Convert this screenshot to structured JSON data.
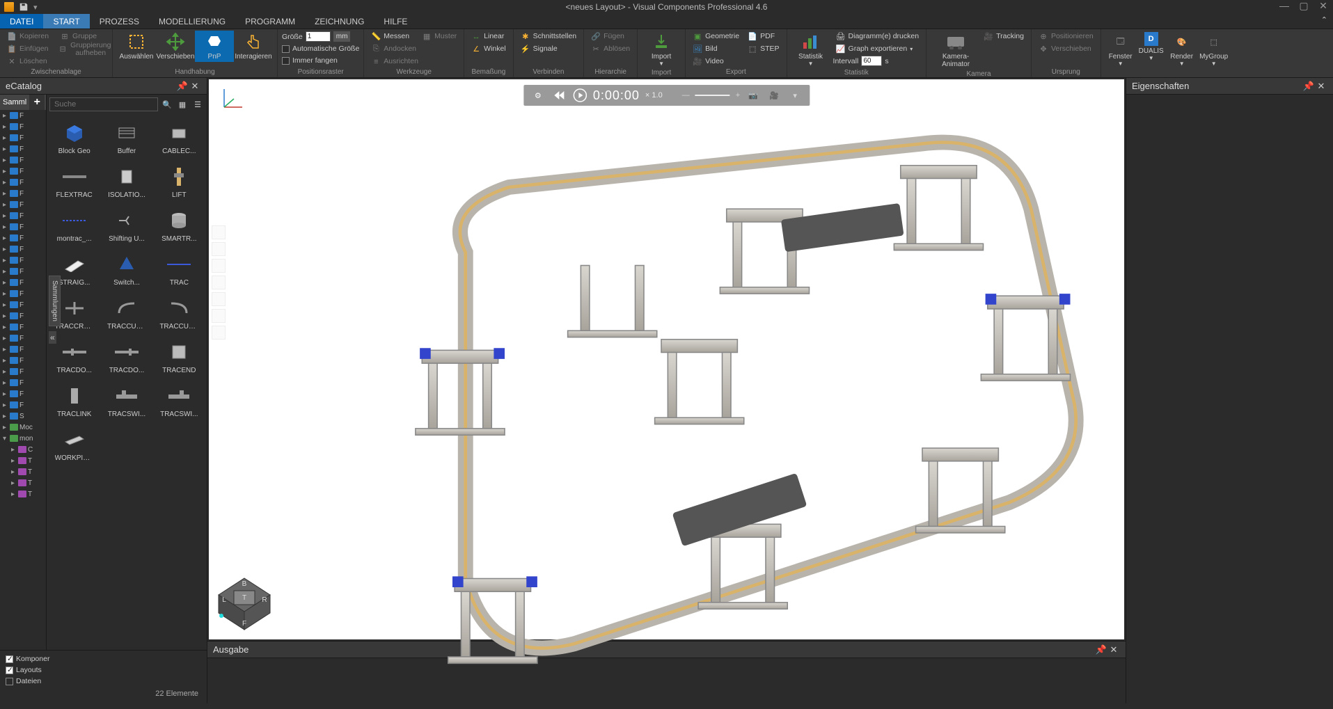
{
  "app": {
    "title": "<neues Layout> - Visual Components Professional 4.6"
  },
  "menu": {
    "tabs": [
      "DATEI",
      "START",
      "PROZESS",
      "MODELLIERUNG",
      "PROGRAMM",
      "ZEICHNUNG",
      "HILFE"
    ],
    "active": 1
  },
  "ribbon": {
    "clipboard": {
      "label": "Zwischenablage",
      "copy": "Kopieren",
      "paste": "Einfügen",
      "delete": "Löschen",
      "group": "Gruppe",
      "ungroup": "Gruppierung aufheben"
    },
    "handling": {
      "label": "Handhabung",
      "select": "Auswählen",
      "move": "Verschieben",
      "pnp": "PnP",
      "interact": "Interagieren"
    },
    "grid": {
      "label": "Positionsraster",
      "size": "Größe",
      "size_val": "1",
      "size_unit": "mm",
      "autosize": "Automatische Größe",
      "snap": "Immer fangen"
    },
    "tools": {
      "label": "Werkzeuge",
      "measure": "Messen",
      "dock": "Andocken",
      "align": "Ausrichten",
      "pattern": "Muster"
    },
    "dimension": {
      "label": "Bemaßung",
      "linear": "Linear",
      "angle": "Winkel"
    },
    "connect": {
      "label": "Verbinden",
      "interfaces": "Schnittstellen",
      "signals": "Signale"
    },
    "hierarchy": {
      "label": "Hierarchie",
      "attach": "Fügen",
      "detach": "Ablösen"
    },
    "import": {
      "label": "Import"
    },
    "export": {
      "label": "Export",
      "geometry": "Geometrie",
      "image": "Bild",
      "video": "Video",
      "pdf": "PDF",
      "step": "STEP"
    },
    "stats": {
      "label": "Statistik",
      "btn": "Statistik",
      "print": "Diagramm(e) drucken",
      "exportg": "Graph exportieren",
      "interval": "Intervall",
      "interval_val": "60",
      "interval_unit": "s"
    },
    "camera": {
      "label": "Kamera",
      "animator": "Kamera-Animator",
      "tracking": "Tracking"
    },
    "origin": {
      "label": "Ursprung",
      "position": "Positionieren",
      "move": "Verschieben"
    },
    "window": {
      "window": "Fenster",
      "dualis": "DUALIS",
      "render": "Render",
      "mygroup": "MyGroup"
    }
  },
  "ecatalog": {
    "title": "eCatalog",
    "collections_tab": "Samml",
    "search_placeholder": "Suche",
    "side_tab": "Sammlungen",
    "tree": [
      {
        "t": "F",
        "c": "b"
      },
      {
        "t": "F",
        "c": "b"
      },
      {
        "t": "F",
        "c": "b"
      },
      {
        "t": "F",
        "c": "b"
      },
      {
        "t": "F",
        "c": "b"
      },
      {
        "t": "F",
        "c": "b"
      },
      {
        "t": "F",
        "c": "b"
      },
      {
        "t": "F",
        "c": "b"
      },
      {
        "t": "F",
        "c": "b"
      },
      {
        "t": "F",
        "c": "b"
      },
      {
        "t": "F",
        "c": "b"
      },
      {
        "t": "F",
        "c": "b"
      },
      {
        "t": "F",
        "c": "b"
      },
      {
        "t": "F",
        "c": "b"
      },
      {
        "t": "F",
        "c": "b"
      },
      {
        "t": "F",
        "c": "b"
      },
      {
        "t": "F",
        "c": "b"
      },
      {
        "t": "F",
        "c": "b"
      },
      {
        "t": "F",
        "c": "b"
      },
      {
        "t": "F",
        "c": "b"
      },
      {
        "t": "F",
        "c": "b"
      },
      {
        "t": "F",
        "c": "b"
      },
      {
        "t": "F",
        "c": "b"
      },
      {
        "t": "F",
        "c": "b"
      },
      {
        "t": "F",
        "c": "b"
      },
      {
        "t": "F",
        "c": "b"
      },
      {
        "t": "F",
        "c": "b"
      },
      {
        "t": "S",
        "c": "b"
      },
      {
        "t": "Moc",
        "c": "g"
      },
      {
        "t": "mon",
        "c": "g",
        "open": true
      },
      {
        "t": "C",
        "c": "p",
        "indent": 1
      },
      {
        "t": "T",
        "c": "p",
        "indent": 1
      },
      {
        "t": "T",
        "c": "p",
        "indent": 1
      },
      {
        "t": "T",
        "c": "p",
        "indent": 1
      },
      {
        "t": "T",
        "c": "p",
        "indent": 1
      }
    ],
    "items": [
      {
        "label": "Block Geo",
        "shape": "cube"
      },
      {
        "label": "Buffer",
        "shape": "buffer"
      },
      {
        "label": "CABLEC...",
        "shape": "cable"
      },
      {
        "label": "FLEXTRAC",
        "shape": "track"
      },
      {
        "label": "ISOLATIO...",
        "shape": "iso"
      },
      {
        "label": "LIFT",
        "shape": "lift"
      },
      {
        "label": "montrac_...",
        "shape": "mtrack"
      },
      {
        "label": "Shifting U...",
        "shape": "shift"
      },
      {
        "label": "SMARTR...",
        "shape": "smart"
      },
      {
        "label": "STRAIG...",
        "shape": "straight"
      },
      {
        "label": "Switch...",
        "shape": "switch"
      },
      {
        "label": "TRAC",
        "shape": "trac"
      },
      {
        "label": "TRACCRO...",
        "shape": "cross"
      },
      {
        "label": "TRACCUR...",
        "shape": "curve1"
      },
      {
        "label": "TRACCUR...",
        "shape": "curve2"
      },
      {
        "label": "TRACDO...",
        "shape": "dock1"
      },
      {
        "label": "TRACDO...",
        "shape": "dock2"
      },
      {
        "label": "TRACEND",
        "shape": "end"
      },
      {
        "label": "TRACLINK",
        "shape": "link"
      },
      {
        "label": "TRACSWI...",
        "shape": "swi1"
      },
      {
        "label": "TRACSWI...",
        "shape": "swi2"
      },
      {
        "label": "WORKPIECE",
        "shape": "wp"
      }
    ],
    "filters": {
      "components": "Komponer",
      "layouts": "Layouts",
      "files": "Dateien"
    },
    "status": "22 Elemente"
  },
  "viewport": {
    "time": "0:00:00",
    "speed": "× 1.0",
    "cube": {
      "top": "T",
      "front": "F",
      "back": "B",
      "left": "L",
      "right": "R"
    }
  },
  "output": {
    "title": "Ausgabe"
  },
  "properties": {
    "title": "Eigenschaften"
  }
}
